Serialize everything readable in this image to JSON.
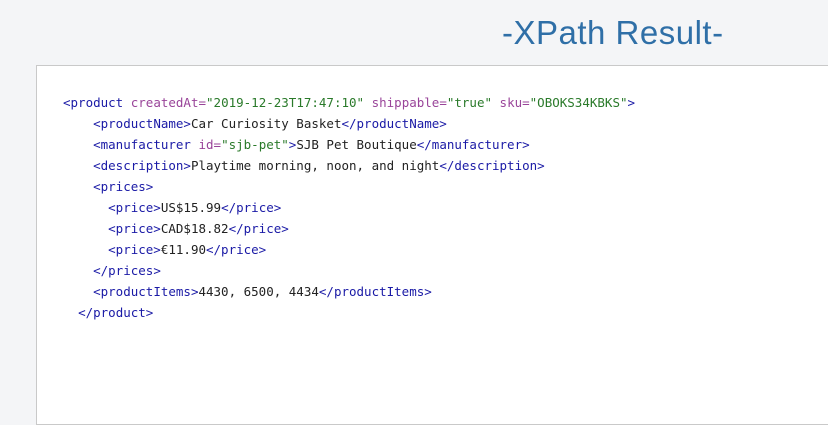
{
  "header": {
    "title": "-XPath Result-"
  },
  "colors": {
    "title": "#2f6fa7",
    "tag": "#1a1aa6",
    "attr": "#994499",
    "value": "#2a7a2a"
  },
  "xml": {
    "l1": {
      "open": "<product",
      "a1_name": " createdAt=",
      "a1_val": "\"2019-12-23T17:47:10\"",
      "a2_name": " shippable=",
      "a2_val": "\"true\"",
      "a3_name": " sku=",
      "a3_val": "\"OBOKS34KBKS\"",
      "close": ">"
    },
    "l2": {
      "indent": "    ",
      "open": "<productName>",
      "text": "Car Curiosity Basket",
      "close": "</productName>"
    },
    "l3": {
      "indent": "    ",
      "open": "<manufacturer",
      "a_name": " id=",
      "a_val": "\"sjb-pet\"",
      "gt": ">",
      "text": "SJB Pet Boutique",
      "close": "</manufacturer>"
    },
    "l4": {
      "indent": "    ",
      "open": "<description>",
      "text": "Playtime morning, noon, and night",
      "close": "</description>"
    },
    "l5": {
      "indent": "    ",
      "open": "<prices>"
    },
    "l6": {
      "indent": "      ",
      "open": "<price>",
      "text": "US$15.99",
      "close": "</price>"
    },
    "l7": {
      "indent": "      ",
      "open": "<price>",
      "text": "CAD$18.82",
      "close": "</price>"
    },
    "l8": {
      "indent": "      ",
      "open": "<price>",
      "text": "€11.90",
      "close": "</price>"
    },
    "l9": {
      "indent": "    ",
      "close": "</prices>"
    },
    "l10": {
      "indent": "    ",
      "open": "<productItems>",
      "text": "4430, 6500, 4434",
      "close": "</productItems>"
    },
    "l11": {
      "indent": "  ",
      "close": "</product>"
    }
  }
}
